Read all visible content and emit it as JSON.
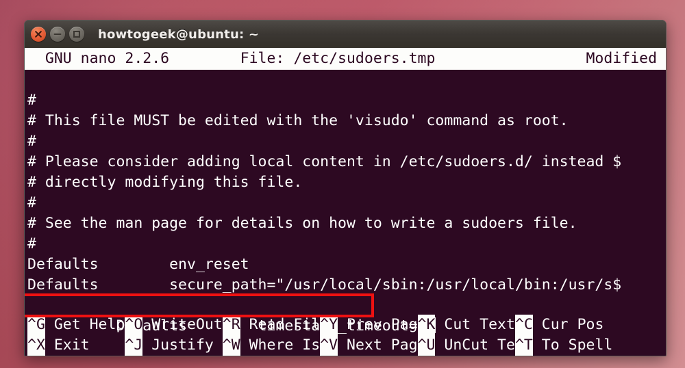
{
  "window": {
    "title": "howtogeek@ubuntu: ~",
    "controls": [
      {
        "name": "close",
        "glyph": "x"
      },
      {
        "name": "minimize",
        "glyph": "-"
      },
      {
        "name": "maximize",
        "glyph": "[]"
      }
    ]
  },
  "nano": {
    "header_left": "  GNU nano 2.2.6",
    "header_center": "File: /etc/sudoers.tmp",
    "header_right": "Modified",
    "header_full": "  GNU nano 2.2.6        File: /etc/sudoers.tmp                 Modified",
    "blank_line": "",
    "lines": [
      "#",
      "# This file MUST be edited with the 'visudo' command as root.",
      "#",
      "# Please consider adding local content in /etc/sudoers.d/ instead $",
      "# directly modifying this file.",
      "#",
      "# See the man page for details on how to write a sudoers file.",
      "#",
      "Defaults        env_reset",
      "Defaults        secure_path=\"/usr/local/sbin:/usr/local/bin:/usr/s$"
    ],
    "highlighted_line": "Defaults        timestamp_timeout=0",
    "cursor_after_text": true,
    "shortcuts_row1": [
      {
        "key": "^G",
        "label": " Get Help"
      },
      {
        "key": "^O",
        "label": " WriteOut"
      },
      {
        "key": "^R",
        "label": " Read Fil"
      },
      {
        "key": "^Y",
        "label": " Prev Pag"
      },
      {
        "key": "^K",
        "label": " Cut Text"
      },
      {
        "key": "^C",
        "label": " Cur Pos"
      }
    ],
    "shortcuts_row2": [
      {
        "key": "^X",
        "label": " Exit    "
      },
      {
        "key": "^J",
        "label": " Justify "
      },
      {
        "key": "^W",
        "label": " Where Is"
      },
      {
        "key": "^V",
        "label": " Next Pag"
      },
      {
        "key": "^U",
        "label": " UnCut Te"
      },
      {
        "key": "^T",
        "label": " To Spell"
      }
    ]
  },
  "colors": {
    "terminal_bg": "#2d0922",
    "terminal_fg": "#ffffff",
    "status_bg": "#fdfdfb",
    "status_fg": "#2d0922",
    "titlebar_bg": "#3b3733",
    "highlight_border": "#ee1111",
    "close_button": "#e8613a",
    "desktop": "#c4596a"
  }
}
